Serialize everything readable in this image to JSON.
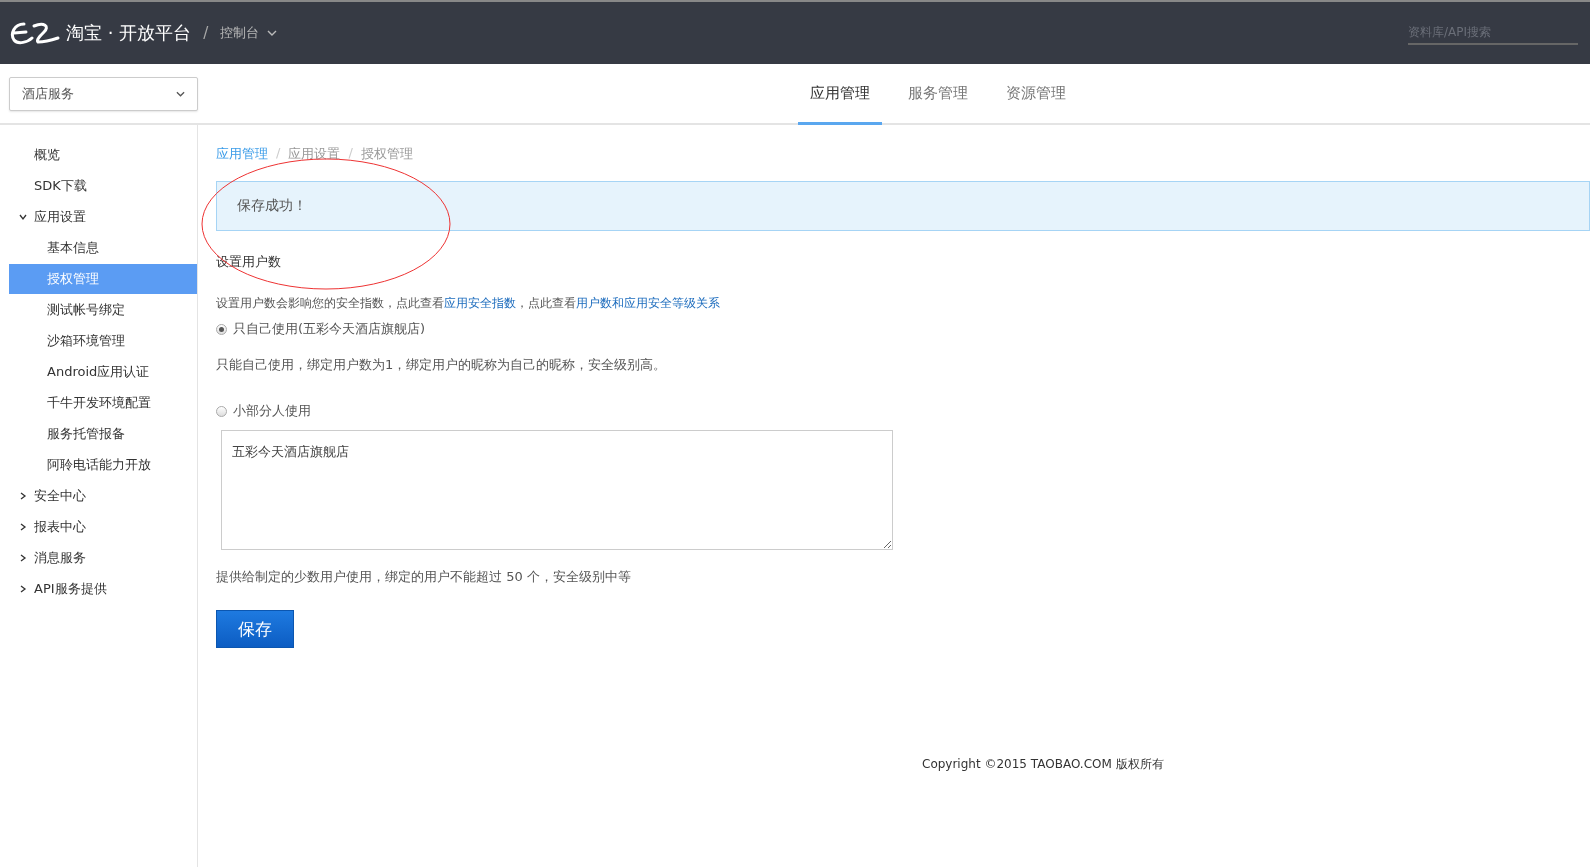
{
  "header": {
    "brand": "淘宝 · 开放平台",
    "separator": "/",
    "console": "控制台",
    "search": {
      "placeholder": "资料库/API搜索"
    }
  },
  "app_select": {
    "value": "酒店服务"
  },
  "tabs": [
    {
      "label": "应用管理",
      "selected": true
    },
    {
      "label": "服务管理",
      "selected": false
    },
    {
      "label": "资源管理",
      "selected": false
    }
  ],
  "sidebar": {
    "items": [
      {
        "label": "概览",
        "selected": false
      },
      {
        "label": "SDK下载",
        "selected": false
      },
      {
        "label": "应用设置",
        "selected": false,
        "expanded": true,
        "children": [
          {
            "label": "基本信息",
            "selected": false
          },
          {
            "label": "授权管理",
            "selected": true
          },
          {
            "label": "测试帐号绑定",
            "selected": false
          },
          {
            "label": "沙箱环境管理",
            "selected": false
          },
          {
            "label": "Android应用认证",
            "selected": false
          },
          {
            "label": "千牛开发环境配置",
            "selected": false
          },
          {
            "label": "服务托管报备",
            "selected": false
          },
          {
            "label": "阿聆电话能力开放",
            "selected": false
          }
        ]
      },
      {
        "label": "安全中心",
        "selected": false,
        "expanded": false
      },
      {
        "label": "报表中心",
        "selected": false,
        "expanded": false
      },
      {
        "label": "消息服务",
        "selected": false,
        "expanded": false
      },
      {
        "label": "API服务提供",
        "selected": false,
        "expanded": false
      }
    ]
  },
  "breadcrumb_separator": "/",
  "breadcrumb": [
    {
      "label": "应用管理",
      "link": true
    },
    {
      "label": "应用设置",
      "link": false
    },
    {
      "label": "授权管理",
      "link": false
    }
  ],
  "alert": "保存成功！",
  "section_title": "设置用户数",
  "description": [
    {
      "text": "设置用户数会影响您的安全指数，点此查看",
      "link": false
    },
    {
      "text": "应用安全指数",
      "link": true
    },
    {
      "text": "，点此查看",
      "link": false
    },
    {
      "text": "用户数和应用安全等级关系",
      "link": true
    }
  ],
  "options": [
    {
      "label": "只自己使用(五彩今天酒店旗舰店)",
      "selected": true,
      "hint": "只能自己使用，绑定用户数为1，绑定用户的昵称为自己的昵称，安全级别高。"
    },
    {
      "label": "小部分人使用",
      "selected": false,
      "value": "五彩今天酒店旗舰店",
      "hint": "提供给制定的少数用户使用，绑定的用户不能超过 50 个，安全级别中等"
    }
  ],
  "save_button": "保存",
  "footer": "Copyright ©2015 TAOBAO.COM 版权所有"
}
